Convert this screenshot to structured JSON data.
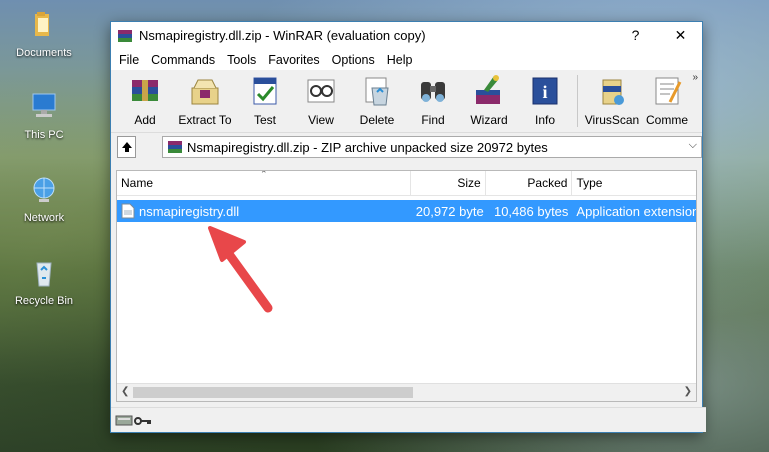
{
  "desktop": {
    "icons": [
      {
        "label": "Documents",
        "icon": "folder-icon"
      },
      {
        "label": "This PC",
        "icon": "computer-icon"
      },
      {
        "label": "Network",
        "icon": "network-icon"
      },
      {
        "label": "Recycle Bin",
        "icon": "recycle-bin-icon"
      }
    ]
  },
  "window": {
    "title": "Nsmapiregistry.dll.zip - WinRAR (evaluation copy)",
    "help_btn": "?",
    "close_btn": "✕"
  },
  "menu": [
    "File",
    "Commands",
    "Tools",
    "Favorites",
    "Options",
    "Help"
  ],
  "toolbar": [
    {
      "label": "Add",
      "icon": "add-archive-icon"
    },
    {
      "label": "Extract To",
      "icon": "extract-to-icon"
    },
    {
      "label": "Test",
      "icon": "test-icon"
    },
    {
      "label": "View",
      "icon": "view-icon"
    },
    {
      "label": "Delete",
      "icon": "delete-icon"
    },
    {
      "label": "Find",
      "icon": "find-icon"
    },
    {
      "label": "Wizard",
      "icon": "wizard-icon"
    },
    {
      "label": "Info",
      "icon": "info-icon"
    },
    {
      "label": "VirusScan",
      "icon": "virusscan-icon"
    },
    {
      "label": "Comme",
      "icon": "comment-icon"
    }
  ],
  "toolbar_more": "»",
  "address": {
    "text": "Nsmapiregistry.dll.zip - ZIP archive unpacked size 20972 bytes",
    "dropdown": "⌵"
  },
  "columns": [
    "Name",
    "Size",
    "Packed",
    "Type"
  ],
  "files": [
    {
      "name": "nsmapiregistry.dll",
      "size": "20,972 byte",
      "packed": "10,486 bytes",
      "type": "Application extension"
    }
  ],
  "colors": {
    "selection": "#3399ff",
    "arrow": "#e8474a",
    "window_border": "#3c7fb1"
  }
}
